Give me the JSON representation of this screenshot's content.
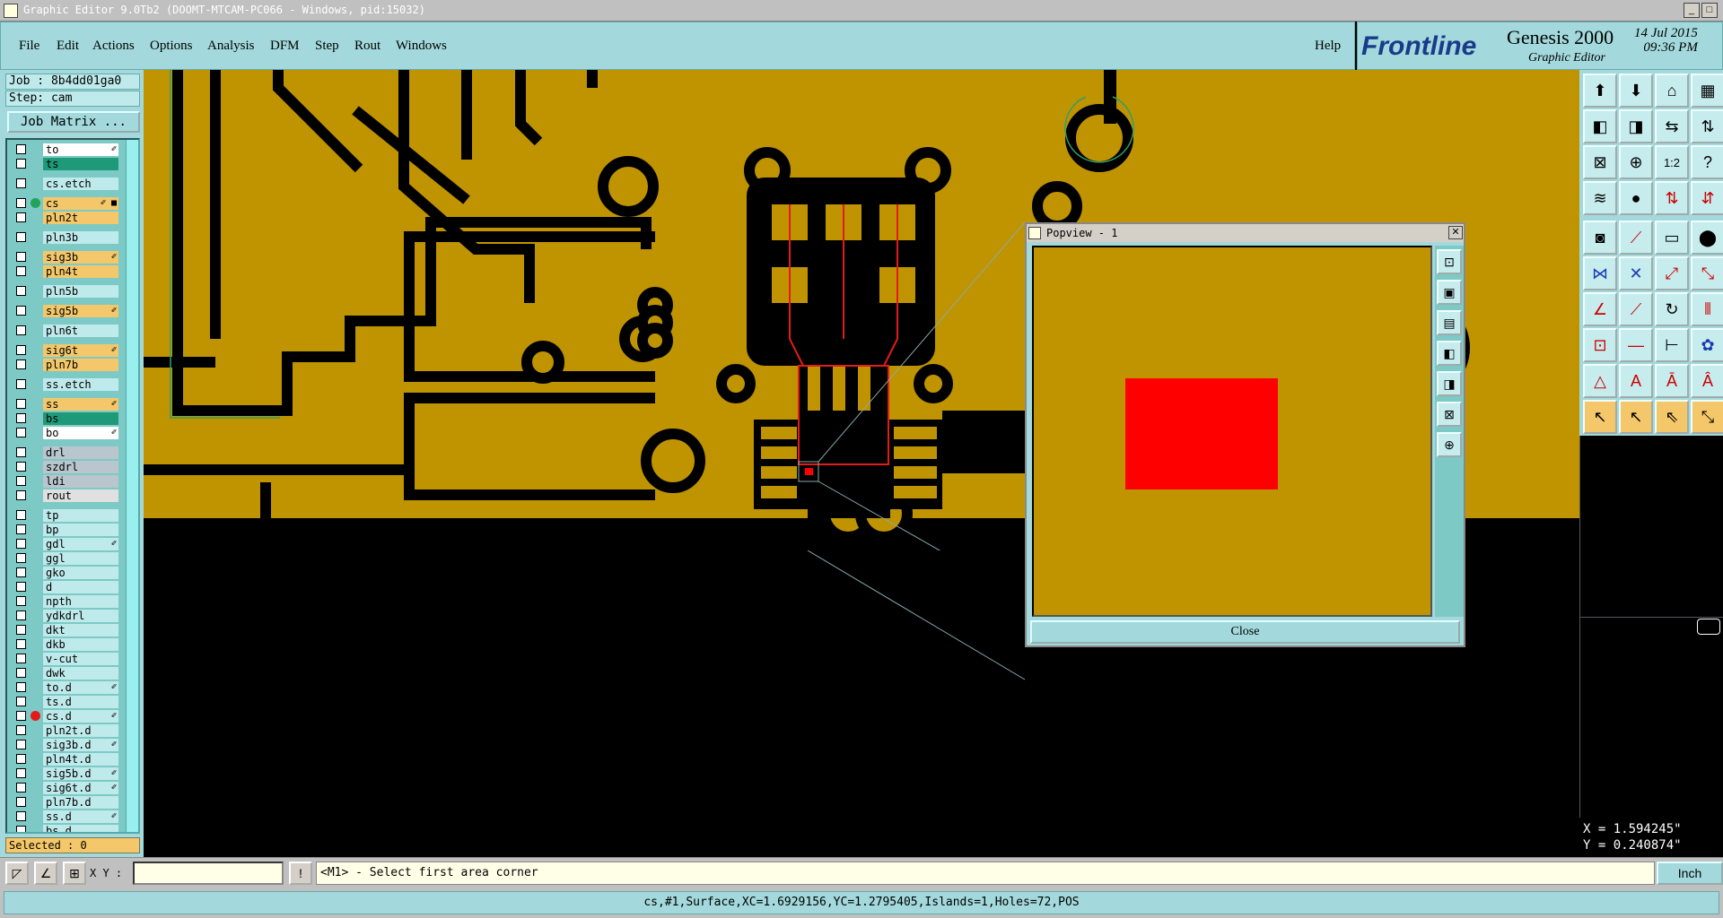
{
  "window": {
    "title": "Graphic Editor 9.0Tb2 (DOOMT-MTCAM-PC066 - Windows, pid:15032)",
    "min": "_",
    "max": "□",
    "close": "✕"
  },
  "menubar": {
    "items": [
      "File",
      "Edit",
      "Actions",
      "Options",
      "Analysis",
      "DFM",
      "Step",
      "Rout",
      "Windows"
    ],
    "help": "Help"
  },
  "brand": {
    "logo": "Frontline",
    "product": "Genesis 2000",
    "subtitle": "Graphic Editor",
    "date": "14 Jul 2015",
    "time": "09:36 PM"
  },
  "job": {
    "job_line": "Job : 8b4dd01ga0",
    "step_line": "Step: cam",
    "job_matrix": "Job Matrix ..."
  },
  "layers": [
    {
      "name": "to",
      "bg": "#ffffff",
      "mark": "✐",
      "group": 0
    },
    {
      "name": "ts",
      "bg": "#1f9a78",
      "mark": "",
      "group": 0
    },
    {
      "name": "cs.etch",
      "bg": "#bfeaec",
      "mark": "",
      "group": 1
    },
    {
      "name": "cs",
      "bg": "#f4c86a",
      "mark": "✐ ■",
      "dot": "#23a35b",
      "group": 2
    },
    {
      "name": "pln2t",
      "bg": "#f4c86a",
      "mark": "",
      "group": 2
    },
    {
      "name": "pln3b",
      "bg": "#bfeaec",
      "mark": "",
      "group": 3
    },
    {
      "name": "sig3b",
      "bg": "#f4c86a",
      "mark": "✐",
      "group": 4
    },
    {
      "name": "pln4t",
      "bg": "#f4c86a",
      "mark": "",
      "group": 4
    },
    {
      "name": "pln5b",
      "bg": "#bfeaec",
      "mark": "",
      "group": 5
    },
    {
      "name": "sig5b",
      "bg": "#f4c86a",
      "mark": "✐",
      "group": 6
    },
    {
      "name": "pln6t",
      "bg": "#bfeaec",
      "mark": "",
      "group": 7
    },
    {
      "name": "sig6t",
      "bg": "#f4c86a",
      "mark": "✐",
      "group": 8
    },
    {
      "name": "pln7b",
      "bg": "#f4c86a",
      "mark": "",
      "group": 8
    },
    {
      "name": "ss.etch",
      "bg": "#bfeaec",
      "mark": "",
      "group": 9
    },
    {
      "name": "ss",
      "bg": "#f4c86a",
      "mark": "✐",
      "group": 10
    },
    {
      "name": "bs",
      "bg": "#1f9a78",
      "mark": "",
      "group": 10
    },
    {
      "name": "bo",
      "bg": "#ffffff",
      "mark": "✐",
      "group": 10
    },
    {
      "name": "drl",
      "bg": "#b9c6ce",
      "mark": "",
      "group": 11
    },
    {
      "name": "szdrl",
      "bg": "#b9c6ce",
      "mark": "",
      "group": 11
    },
    {
      "name": "ldi",
      "bg": "#b9c6ce",
      "mark": "",
      "group": 11
    },
    {
      "name": "rout",
      "bg": "#e0e0e0",
      "mark": "",
      "group": 11
    },
    {
      "name": "tp",
      "bg": "#bfeaec",
      "mark": "",
      "group": 12
    },
    {
      "name": "bp",
      "bg": "#bfeaec",
      "mark": "",
      "group": 12
    },
    {
      "name": "gdl",
      "bg": "#bfeaec",
      "mark": "✐",
      "group": 12
    },
    {
      "name": "ggl",
      "bg": "#bfeaec",
      "mark": "",
      "group": 12
    },
    {
      "name": "gko",
      "bg": "#bfeaec",
      "mark": "",
      "group": 12
    },
    {
      "name": "d",
      "bg": "#bfeaec",
      "mark": "",
      "group": 12
    },
    {
      "name": "npth",
      "bg": "#bfeaec",
      "mark": "",
      "group": 12
    },
    {
      "name": "ydkdrl",
      "bg": "#bfeaec",
      "mark": "",
      "group": 12
    },
    {
      "name": "dkt",
      "bg": "#bfeaec",
      "mark": "",
      "group": 12
    },
    {
      "name": "dkb",
      "bg": "#bfeaec",
      "mark": "",
      "group": 12
    },
    {
      "name": "v-cut",
      "bg": "#bfeaec",
      "mark": "",
      "group": 12
    },
    {
      "name": "dwk",
      "bg": "#bfeaec",
      "mark": "",
      "group": 12
    },
    {
      "name": "to.d",
      "bg": "#bfeaec",
      "mark": "✐",
      "group": 12
    },
    {
      "name": "ts.d",
      "bg": "#bfeaec",
      "mark": "",
      "group": 12
    },
    {
      "name": "cs.d",
      "bg": "#bfeaec",
      "mark": "✐",
      "dot": "#e31b1b",
      "group": 12
    },
    {
      "name": "pln2t.d",
      "bg": "#bfeaec",
      "mark": "",
      "group": 12
    },
    {
      "name": "sig3b.d",
      "bg": "#bfeaec",
      "mark": "✐",
      "group": 12
    },
    {
      "name": "pln4t.d",
      "bg": "#bfeaec",
      "mark": "",
      "group": 12
    },
    {
      "name": "sig5b.d",
      "bg": "#bfeaec",
      "mark": "✐",
      "group": 12
    },
    {
      "name": "sig6t.d",
      "bg": "#bfeaec",
      "mark": "✐",
      "group": 12
    },
    {
      "name": "pln7b.d",
      "bg": "#bfeaec",
      "mark": "",
      "group": 12
    },
    {
      "name": "ss.d",
      "bg": "#bfeaec",
      "mark": "✐",
      "group": 12
    },
    {
      "name": "bs.d",
      "bg": "#bfeaec",
      "mark": "",
      "group": 12
    }
  ],
  "selected": "Selected : 0",
  "popview": {
    "title": "Popview - 1",
    "close_label": "Close",
    "feature_color": "#ff0000",
    "copper_color": "#bf9400"
  },
  "coords": {
    "x": "X = 1.594245\"",
    "y": "Y = 0.240874\""
  },
  "statusbar": {
    "xy_label": "X Y :",
    "xy_value": "",
    "prompt": "<M1> - Select first area corner",
    "units": "Inch",
    "prompt_icon": "!"
  },
  "infobar": {
    "text": "cs,#1,Surface,XC=1.6929156,YC=1.2795405,Islands=1,Holes=72,POS"
  }
}
